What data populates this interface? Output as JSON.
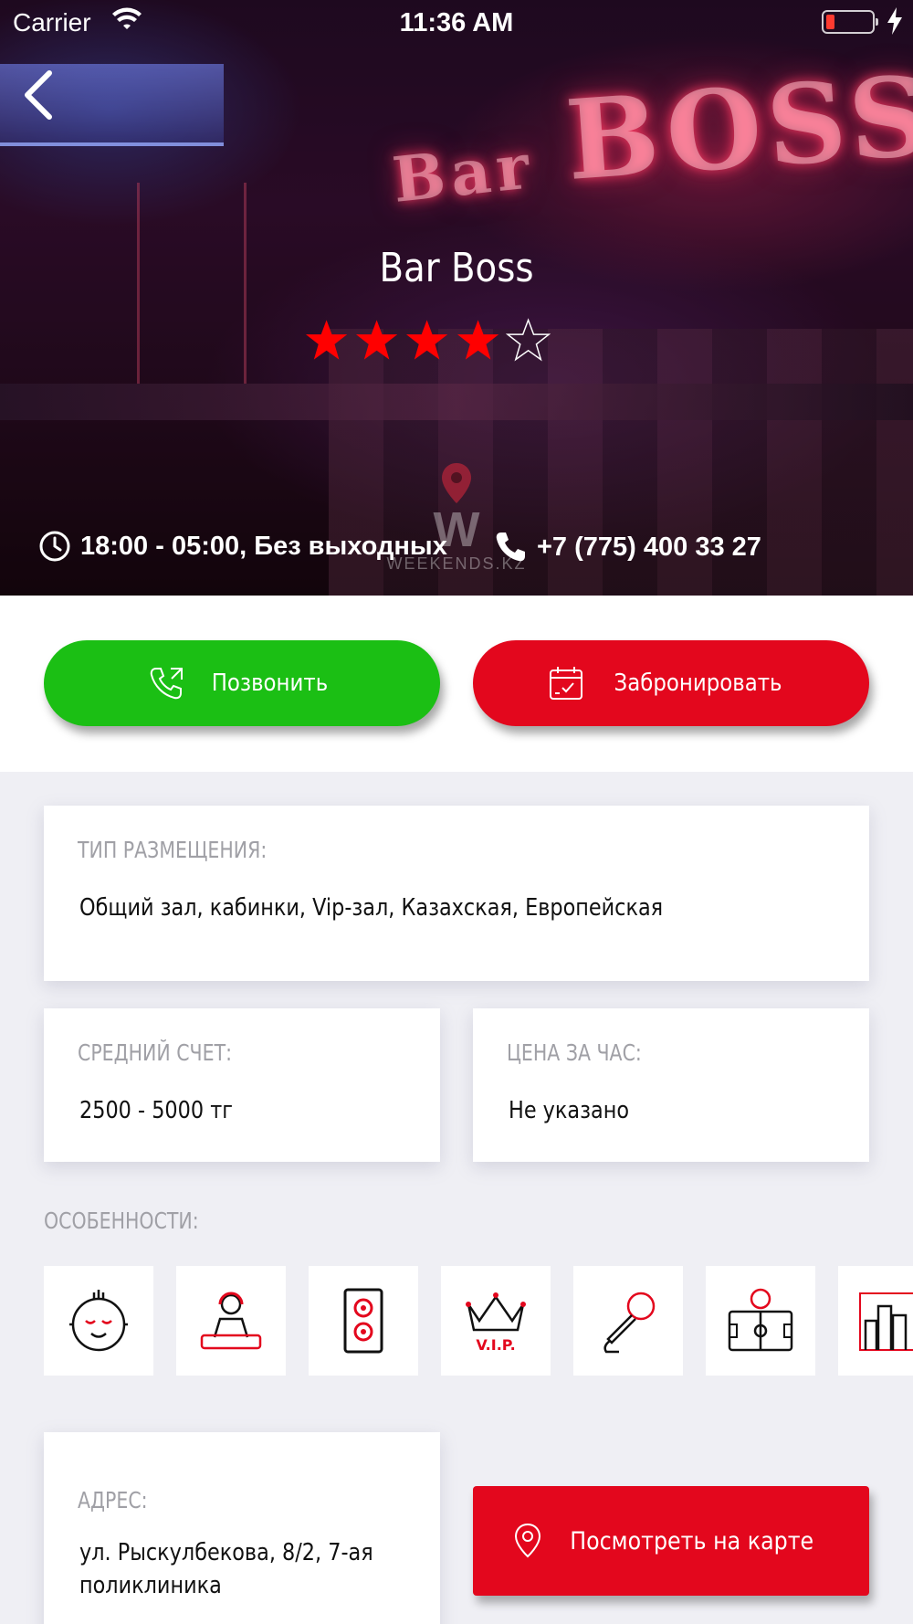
{
  "status_bar": {
    "carrier": "Carrier",
    "time": "11:36 AM",
    "battery_icon": "battery-low-icon",
    "charging_icon": "charging-bolt-icon"
  },
  "hero": {
    "title": "Bar Boss",
    "rating": {
      "value": 4,
      "max": 5,
      "filled_color": "#ff0000"
    },
    "hours": "18:00 - 05:00, Без выходных",
    "phone": "+7 (775) 400 33 27",
    "watermark": "WEEKENDS.KZ",
    "neon_sign_1": "Bar",
    "neon_sign_2": "BOSS"
  },
  "actions": {
    "call_label": "Позвонить",
    "book_label": "Забронировать",
    "call_color": "#1bbf14",
    "book_color": "#e3071d"
  },
  "placement": {
    "label": "ТИП РАЗМЕЩЕНИЯ:",
    "value": "Общий зал, кабинки, Vip-зал, Казахская, Европейская"
  },
  "average_bill": {
    "label": "СРЕДНИЙ СЧЕТ:",
    "value": "2500 - 5000 тг"
  },
  "hourly_price": {
    "label": "ЦЕНА ЗА ЧАС:",
    "value": "Не указано"
  },
  "features": {
    "title": "ОСОБЕННОСТИ:",
    "items": [
      {
        "icon": "kids-face-icon"
      },
      {
        "icon": "dj-icon"
      },
      {
        "icon": "speaker-icon"
      },
      {
        "icon": "vip-crown-icon",
        "text": "V.I.P."
      },
      {
        "icon": "karaoke-microphone-icon"
      },
      {
        "icon": "sports-screen-icon"
      },
      {
        "icon": "city-view-icon"
      }
    ]
  },
  "address": {
    "label": "АДРЕС:",
    "value": "ул. Рыскулбекова, 8/2, 7-ая поликлиника"
  },
  "map_button": {
    "label": "Посмотреть на карте"
  }
}
